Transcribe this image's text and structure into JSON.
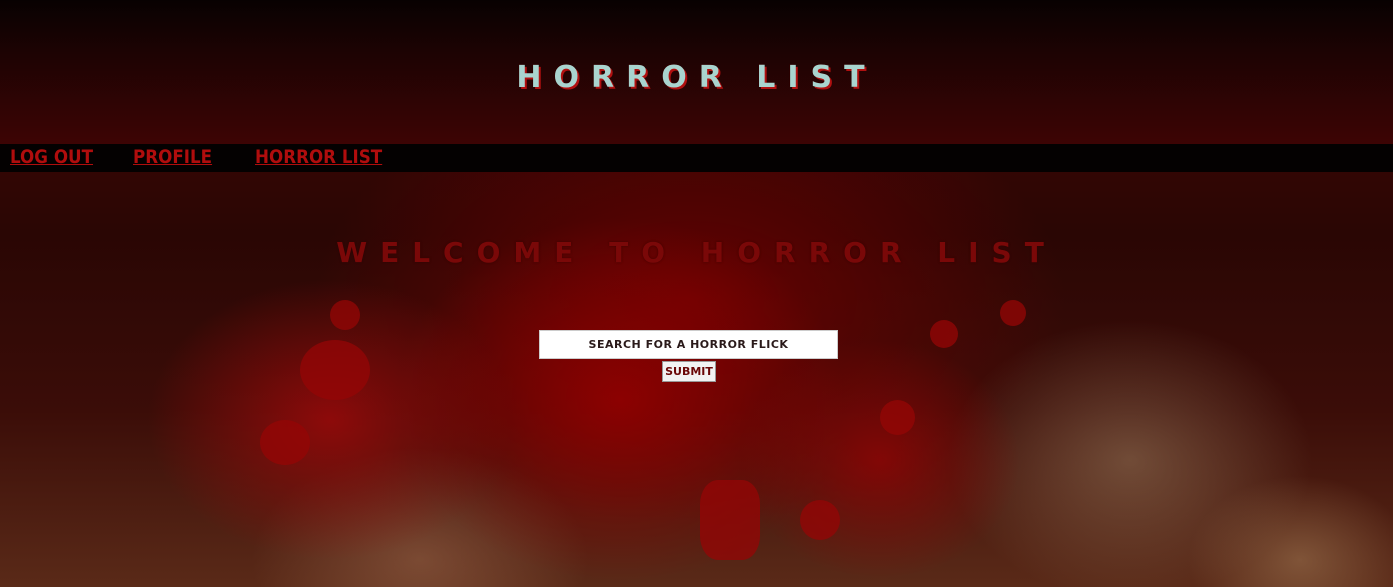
{
  "header": {
    "site_title": "HORROR LIST"
  },
  "nav": {
    "items": [
      {
        "label": "LOG OUT"
      },
      {
        "label": "PROFILE"
      },
      {
        "label": "HORROR LIST"
      }
    ]
  },
  "main": {
    "welcome_heading": "WELCOME TO HORROR LIST",
    "search": {
      "placeholder": "SEARCH FOR A HORROR FLICK",
      "value": ""
    },
    "submit_label": "SUBMIT"
  },
  "colors": {
    "nav_link": "#b00d0d",
    "title": "#a9d4cf",
    "welcome": "#7a0808",
    "navbar_bg": "#040101"
  }
}
